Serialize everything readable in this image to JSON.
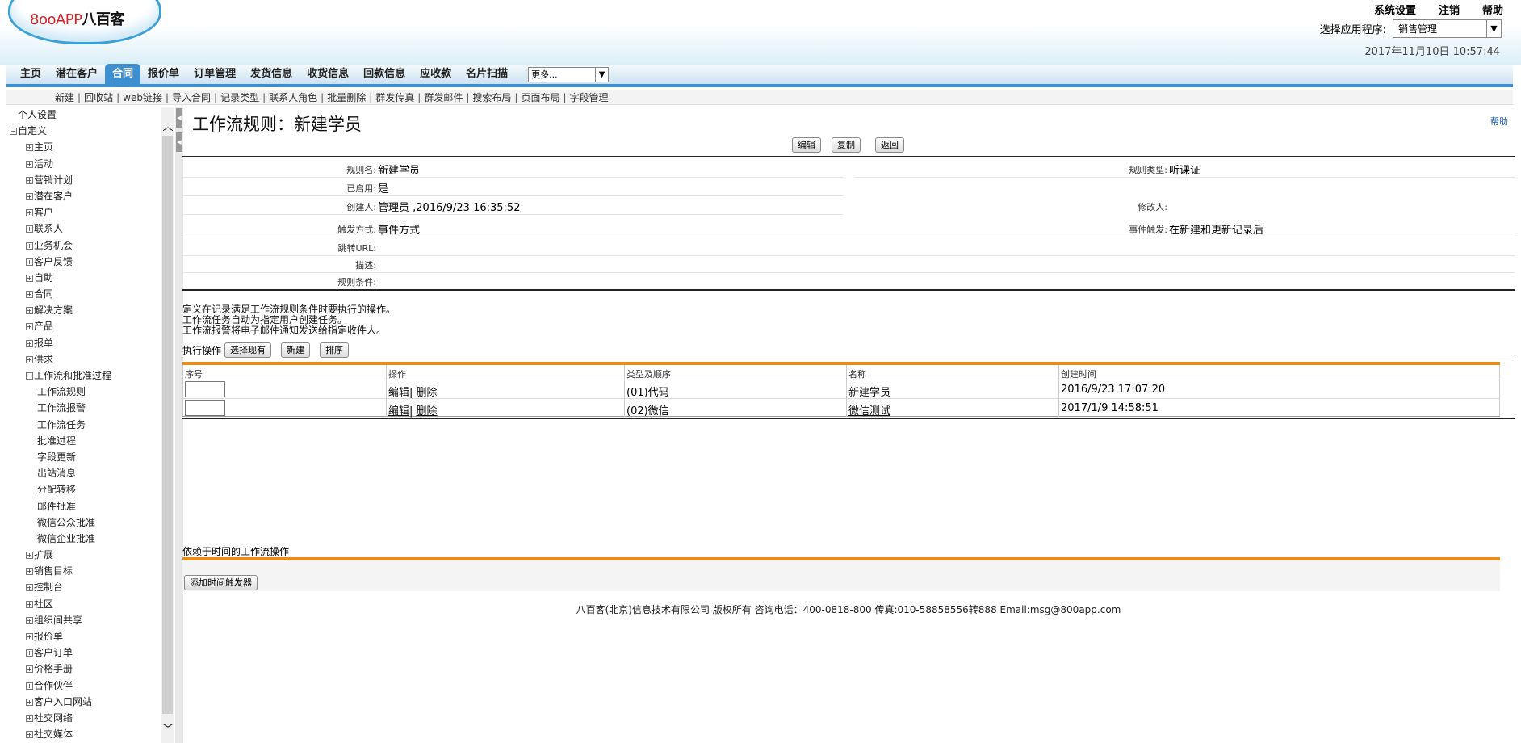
{
  "header": {
    "logo_main": "8ooAPP",
    "logo_cn": "八百客",
    "top_links": [
      "系统设置",
      "注销",
      "帮助"
    ],
    "app_selector_label": "选择应用程序:",
    "app_selector_value": "销售管理",
    "datetime": "2017年11月10日 10:57:44"
  },
  "nav": {
    "tabs": [
      "主页",
      "潜在客户",
      "合同",
      "报价单",
      "订单管理",
      "发货信息",
      "收货信息",
      "回款信息",
      "应收款",
      "名片扫描"
    ],
    "active": "合同",
    "more_label": "更多..."
  },
  "subnav": [
    "新建",
    "回收站",
    "web链接",
    "导入合同",
    "记录类型",
    "联系人角色",
    "批量删除",
    "群发传真",
    "群发邮件",
    "搜索布局",
    "页面布局",
    "字段管理"
  ],
  "sidebar": {
    "personal": "个人设置",
    "custom": "自定义",
    "items": [
      "主页",
      "活动",
      "营销计划",
      "潜在客户",
      "客户",
      "联系人",
      "业务机会",
      "客户反馈",
      "自助",
      "合同",
      "解决方案",
      "产品",
      "报单",
      "供求"
    ],
    "workflow_group": "工作流和批准过程",
    "workflow_children": [
      "工作流规则",
      "工作流报警",
      "工作流任务",
      "批准过程",
      "字段更新",
      "出站消息",
      "分配转移",
      "邮件批准",
      "微信公众批准",
      "微信企业批准"
    ],
    "more_items": [
      "扩展",
      "销售目标",
      "控制台",
      "社区",
      "组织间共享",
      "报价单",
      "客户订单",
      "价格手册",
      "合作伙伴",
      "客户入口网站",
      "社交网络",
      "社交媒体"
    ]
  },
  "main": {
    "title": "工作流规则：新建学员",
    "help": "帮助",
    "buttons": [
      "编辑",
      "复制",
      "返回"
    ],
    "fields": {
      "rule_name_label": "规则名:",
      "rule_name": "新建学员",
      "rule_type_label": "规则类型:",
      "rule_type": "听课证",
      "enabled_label": "已启用:",
      "enabled": "是",
      "creator_label": "创建人:",
      "creator": "管理员",
      "created_at": ",2016/9/23 16:35:52",
      "modifier_label": "修改人:",
      "trigger_label": "触发方式:",
      "trigger": "事件方式",
      "event_label": "事件触发:",
      "event": "在新建和更新记录后",
      "jump_url_label": "跳转URL:",
      "desc_label": "描述:",
      "condition_label": "规则条件:"
    },
    "description_lines": [
      "定义在记录满足工作流规则条件时要执行的操作。",
      "工作流任务自动为指定用户创建任务。",
      "工作流报警将电子邮件通知发送给指定收件人。"
    ],
    "exec_label": "执行操作",
    "exec_buttons": [
      "选择现有",
      "新建",
      "排序"
    ],
    "table": {
      "headers": [
        "序号",
        "操作",
        "类型及顺序",
        "名称",
        "创建时间"
      ],
      "rows": [
        {
          "edit": "编辑",
          "del": "删除",
          "type": "(01)代码",
          "name": "新建学员",
          "created": "2016/9/23 17:07:20"
        },
        {
          "edit": "编辑",
          "del": "删除",
          "type": "(02)微信",
          "name": "微信测试",
          "created": "2017/1/9 14:58:51"
        }
      ]
    },
    "time_section_title": "依赖于时间的工作流操作",
    "time_button": "添加时间触发器",
    "footer": "八百客(北京)信息技术有限公司 版权所有 咨询电话：400-0818-800 传真:010-58858556转888 Email:msg@800app.com"
  },
  "colors": {
    "accent": "#3d8fcf",
    "table_border": "#e98c1d"
  }
}
